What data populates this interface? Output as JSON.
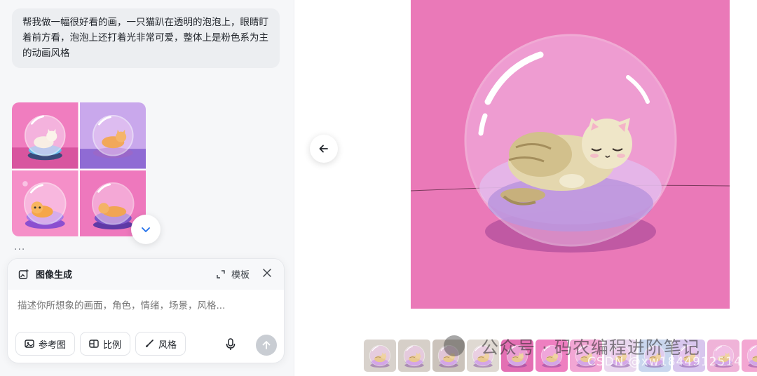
{
  "chat": {
    "user_prompt": "帮我做一幅很好看的画，一只猫趴在透明的泡泡上，眼睛盯着前方看，泡泡上还打着光非常可爱，整体上是粉色系为主的动画风格",
    "more_label": "...",
    "result_images": [
      {
        "icon": "cat-bubble-image-1"
      },
      {
        "icon": "cat-bubble-image-2"
      },
      {
        "icon": "cat-bubble-image-3"
      },
      {
        "icon": "cat-bubble-image-4"
      }
    ]
  },
  "composer": {
    "mode_label": "图像生成",
    "template_label": "模板",
    "placeholder": "描述你所想象的画面，角色，情绪，场景，风格...",
    "reference_label": "参考图",
    "ratio_label": "比例",
    "style_label": "风格"
  },
  "preview": {
    "thumbnail_count": 12
  },
  "watermark": {
    "main": "公众号 · 码农编程进阶笔记",
    "secondary": "CSDN @xw1844912514"
  },
  "colors": {
    "accent": "#1f6feb",
    "pink_bg": "#ea79b8",
    "panel_bg": "#f6f7f9"
  }
}
